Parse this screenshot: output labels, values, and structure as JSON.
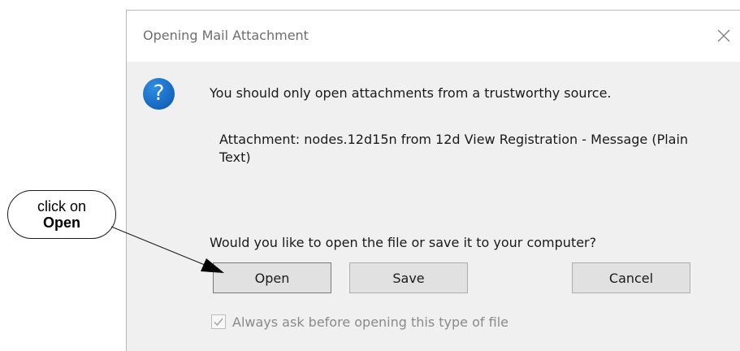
{
  "dialog": {
    "title": "Opening Mail Attachment",
    "message": "You should only open attachments from a trustworthy source.",
    "attachment_info": "Attachment: nodes.12d15n from 12d View Registration - Message (Plain Text)",
    "question": "Would you like to open the file or save it to your computer?",
    "buttons": {
      "open": "Open",
      "save": "Save",
      "cancel": "Cancel"
    },
    "checkbox": {
      "label": "Always ask before opening this type of file",
      "checked": true
    },
    "icon_question_mark": "?"
  },
  "annotation": {
    "line1": "click on",
    "line2": "Open"
  },
  "colors": {
    "icon_blue": "#1565c0",
    "dialog_bg": "#f0f0f0",
    "button_bg": "#e1e1e1"
  }
}
